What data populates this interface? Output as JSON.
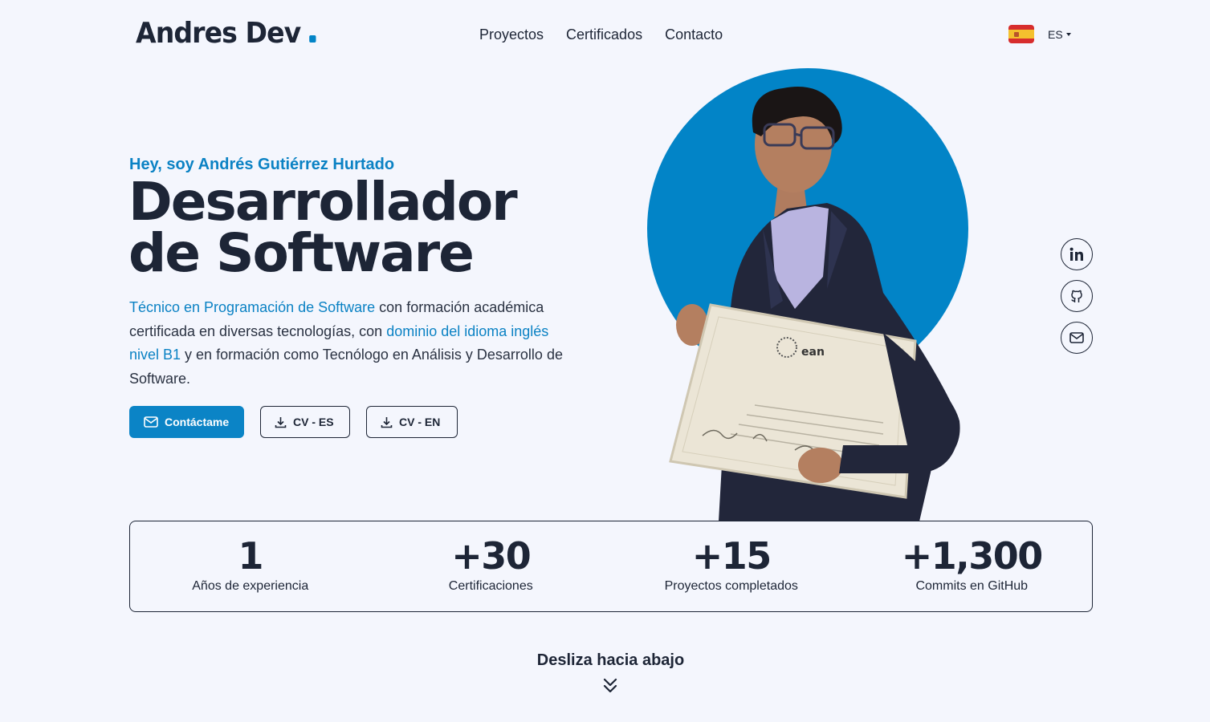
{
  "header": {
    "logo": "Andres Dev",
    "nav": [
      "Proyectos",
      "Certificados",
      "Contacto"
    ],
    "language": {
      "code": "ES",
      "flag": "spain-flag-icon"
    }
  },
  "hero": {
    "greeting": "Hey, soy Andrés Gutiérrez Hurtado",
    "title_line1": "Desarrollador",
    "title_line2": "de Software",
    "description": {
      "hl1": "Técnico en Programación de Software",
      "t1": " con formación académica certificada en diversas tecnologías, con ",
      "hl2": "dominio del idioma inglés nivel B1",
      "t2": " y en formación como Tecnólogo en Análisis y Desarrollo de Software."
    },
    "buttons": {
      "contact": "Contáctame",
      "cv_es": "CV - ES",
      "cv_en": "CV - EN"
    }
  },
  "social": [
    "linkedin-icon",
    "github-icon",
    "mail-icon"
  ],
  "stats": [
    {
      "value": "1",
      "label": "Años de experiencia"
    },
    {
      "value": "+30",
      "label": "Certificaciones"
    },
    {
      "value": "+15",
      "label": "Proyectos completados"
    },
    {
      "value": "+1,300",
      "label": "Commits en GitHub"
    }
  ],
  "scroll_hint": "Desliza hacia abajo",
  "colors": {
    "accent": "#0b84c6",
    "text": "#1d2536",
    "background": "#f4f6fd"
  }
}
